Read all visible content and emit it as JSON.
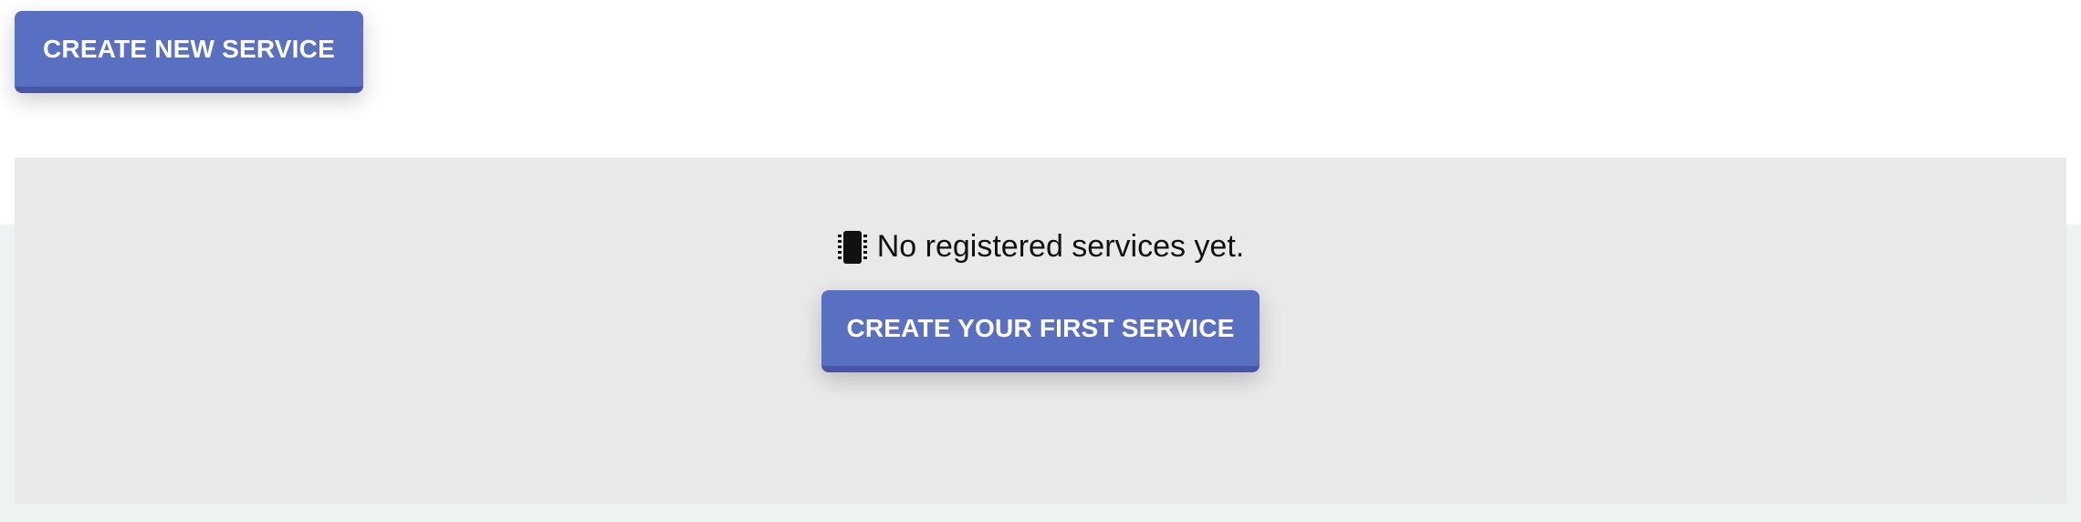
{
  "toolbar": {
    "create_new_label": "CREATE NEW SERVICE"
  },
  "empty_state": {
    "icon": "chip-icon",
    "message": "No registered services yet.",
    "create_first_label": "CREATE YOUR FIRST SERVICE"
  },
  "colors": {
    "button_bg": "#596fc2",
    "button_border": "#4655a6",
    "panel_bg": "#e9e9e9",
    "page_band_bg": "#eff2f3"
  }
}
